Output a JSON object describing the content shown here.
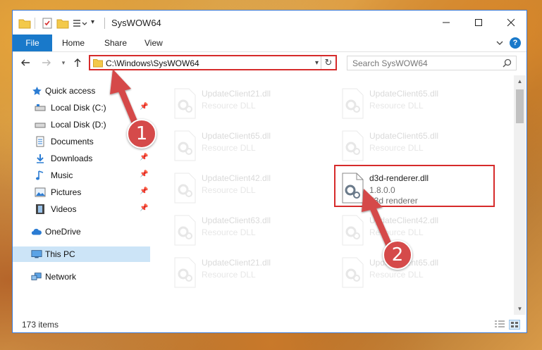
{
  "window": {
    "title": "SysWOW64",
    "controls": [
      "minimize",
      "maximize",
      "close"
    ]
  },
  "ribbon": {
    "tabs": [
      {
        "label": "File",
        "active": true
      },
      {
        "label": "Home"
      },
      {
        "label": "Share"
      },
      {
        "label": "View"
      }
    ]
  },
  "address": {
    "path": "C:\\Windows\\SysWOW64",
    "search_placeholder": "Search SysWOW64"
  },
  "nav": {
    "items": [
      {
        "label": "Quick access",
        "icon": "star-icon"
      },
      {
        "label": "Local Disk (C:)",
        "icon": "drive-icon",
        "pinned": true
      },
      {
        "label": "Local Disk (D:)",
        "icon": "drive-icon"
      },
      {
        "label": "Documents",
        "icon": "documents-icon"
      },
      {
        "label": "Downloads",
        "icon": "download-icon",
        "pinned": true
      },
      {
        "label": "Music",
        "icon": "music-icon",
        "pinned": true
      },
      {
        "label": "Pictures",
        "icon": "pictures-icon",
        "pinned": true
      },
      {
        "label": "Videos",
        "icon": "videos-icon",
        "pinned": true
      },
      {
        "label": "OneDrive",
        "icon": "cloud-icon"
      },
      {
        "label": "This PC",
        "icon": "monitor-icon",
        "selected": true
      },
      {
        "label": "Network",
        "icon": "network-icon"
      }
    ]
  },
  "files": [
    {
      "name": "UpdateClient21.dll",
      "sub1": "Resource DLL",
      "sub2": "",
      "faded": true
    },
    {
      "name": "UpdateClient65.dll",
      "sub1": "Resource DLL",
      "sub2": "",
      "faded": true
    },
    {
      "name": "UpdateClient65.dll",
      "sub1": "Resource DLL",
      "sub2": "",
      "faded": true
    },
    {
      "name": "UpdateClient65.dll",
      "sub1": "Resource DLL",
      "sub2": "",
      "faded": true
    },
    {
      "name": "UpdateClient42.dll",
      "sub1": "Resource DLL",
      "sub2": "",
      "faded": true
    },
    {
      "name": "d3d-renderer.dll",
      "sub1": "1.8.0.0",
      "sub2": "d3d renderer",
      "faded": false,
      "highlighted": true
    },
    {
      "name": "UpdateClient63.dll",
      "sub1": "Resource DLL",
      "sub2": "",
      "faded": true
    },
    {
      "name": "UpdateClient42.dll",
      "sub1": "Resource DLL",
      "sub2": "",
      "faded": true
    },
    {
      "name": "UpdateClient21.dll",
      "sub1": "Resource DLL",
      "sub2": "",
      "faded": true
    },
    {
      "name": "UpdateClient65.dll",
      "sub1": "Resource DLL",
      "sub2": "",
      "faded": true
    }
  ],
  "status": {
    "item_count": "173 items"
  },
  "annotations": {
    "step1": "1",
    "step2": "2",
    "color": "#d54a4a"
  }
}
